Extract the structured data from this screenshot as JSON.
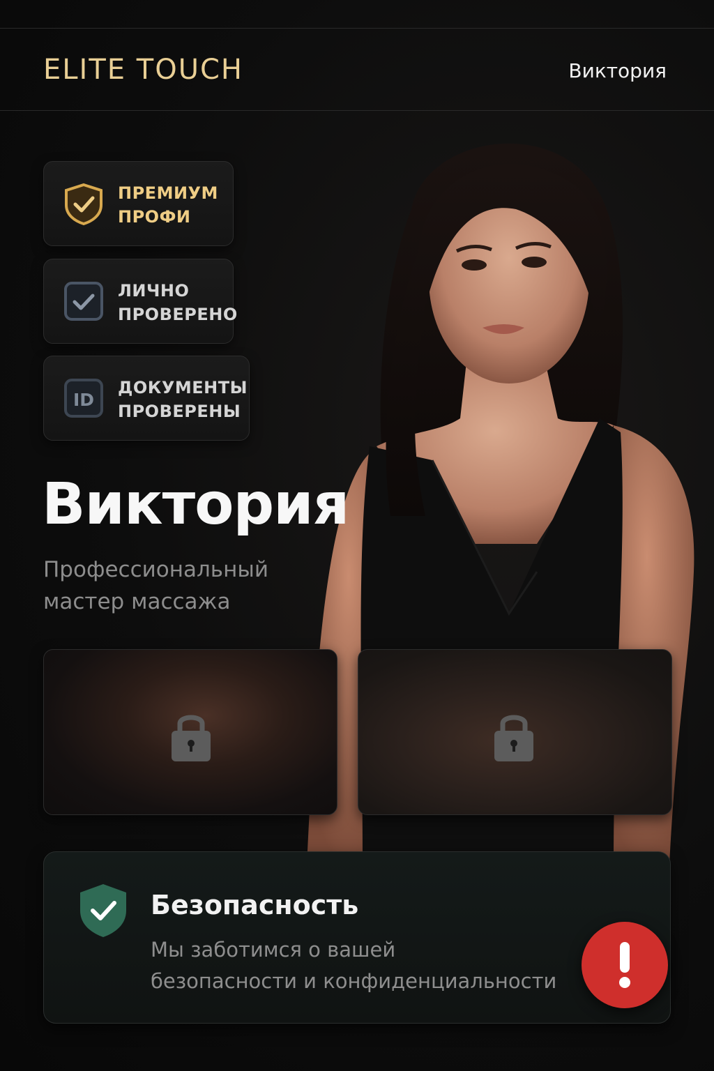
{
  "header": {
    "brand": "ELITE TOUCH",
    "user_name": "Виктория"
  },
  "badges": [
    {
      "line1": "ПРЕМИУМ",
      "line2": "ПРОФИ",
      "icon": "shield-check-icon"
    },
    {
      "line1": "ЛИЧНО",
      "line2": "ПРОВЕРЕНО",
      "icon": "checkbox-icon"
    },
    {
      "line1": "ДОКУМЕНТЫ",
      "line2": "ПРОВЕРЕНЫ",
      "icon": "id-icon",
      "icon_text": "ID"
    }
  ],
  "profile": {
    "name": "Виктория",
    "subtitle_line1": "Профессиональный",
    "subtitle_line2": "мастер массажа"
  },
  "gallery": [
    {
      "icon": "lock-icon",
      "locked": true
    },
    {
      "icon": "lock-icon",
      "locked": true
    }
  ],
  "security": {
    "title": "Безопасность",
    "text_line1": "Мы заботимся о вашей",
    "text_line2": "безопасности и конфиденциальности",
    "icon": "shield-check-icon"
  },
  "alert_button": {
    "icon": "exclamation-icon",
    "color": "#cf2f2c"
  },
  "colors": {
    "accent_gold": "#e9cf95",
    "security_green": "#2f6b55"
  }
}
